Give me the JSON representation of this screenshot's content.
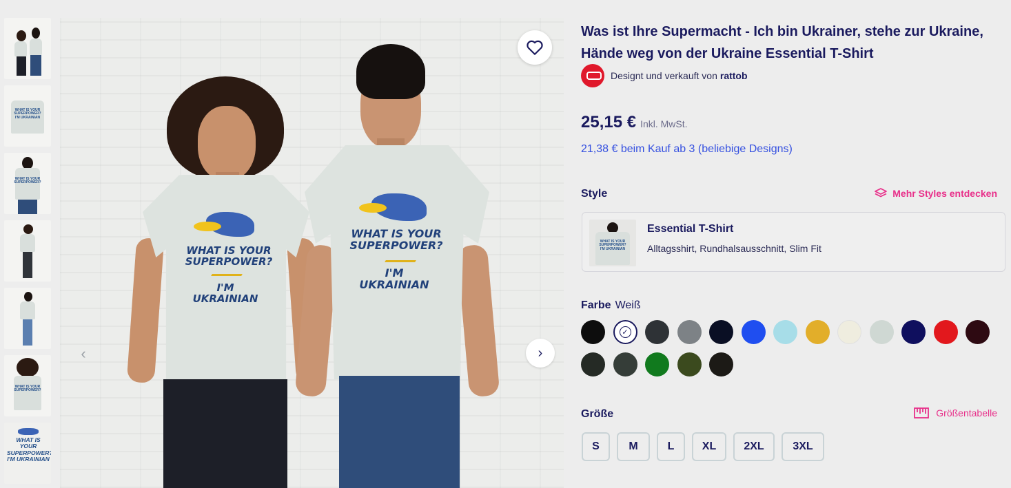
{
  "product": {
    "title": "Was ist Ihre Supermacht - Ich bin Ukrainer, stehe zur Ukraine, Hände weg von der Ukraine Essential T-Shirt",
    "seller_prefix": "Designt und verkauft von",
    "seller_name": "rattob",
    "price": "25,15 €",
    "price_tax_note": "Inkl. MwSt.",
    "bulk_offer": "21,38 € beim Kauf ab 3 (beliebige Designs)"
  },
  "print_text": {
    "line1": "WHAT IS YOUR",
    "line2": "SUPERPOWER?",
    "line3": "I'M UKRAINIAN"
  },
  "style": {
    "label": "Style",
    "more_link": "Mehr Styles entdecken",
    "selected_name": "Essential T-Shirt",
    "selected_desc": "Alltagsshirt, Rundhalsausschnitt, Slim Fit"
  },
  "color": {
    "label": "Farbe",
    "selected": "Weiß",
    "swatches": [
      "#0d0d0d",
      "#ffffff",
      "#2e3236",
      "#7d8286",
      "#0a0f24",
      "#1f4ef0",
      "#a7dde8",
      "#e2ae2a",
      "#efeddf",
      "#cfd8d3",
      "#0f0f5e",
      "#e2181d",
      "#2e0a12",
      "#252a25",
      "#353d38",
      "#117a1e",
      "#3b4a1e",
      "#1c1a16"
    ]
  },
  "size": {
    "label": "Größe",
    "chart_link": "Größentabelle",
    "options": [
      "S",
      "M",
      "L",
      "XL",
      "2XL",
      "3XL"
    ]
  },
  "icons": {
    "favorite": "heart-icon",
    "prev": "chevron-left-icon",
    "next": "chevron-right-icon",
    "styles": "layers-icon",
    "size_chart": "ruler-icon"
  }
}
